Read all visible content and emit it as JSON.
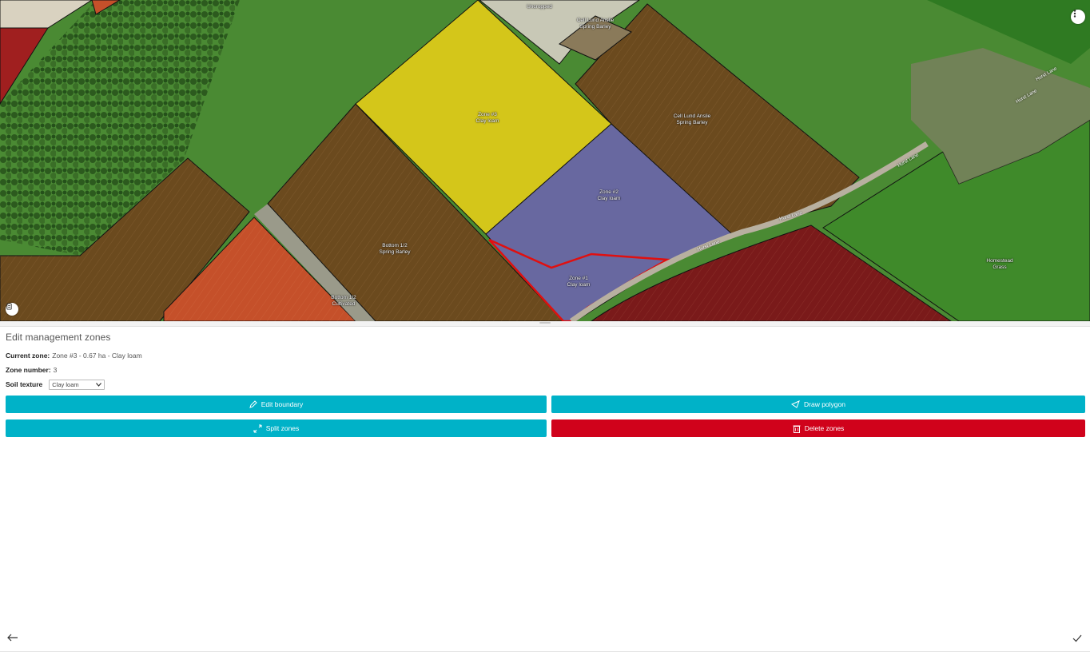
{
  "map": {
    "field_labels": [
      {
        "id": "zone3",
        "lines": [
          "Zone #3",
          "Clay loam"
        ]
      },
      {
        "id": "zone2",
        "lines": [
          "Zone #2",
          "Clay loam"
        ]
      },
      {
        "id": "zone1",
        "lines": [
          "Zone #1",
          "Clay loam"
        ]
      },
      {
        "id": "cell-upper",
        "lines": [
          "Cell Lund Anslie",
          "Spring Barley"
        ]
      },
      {
        "id": "bottom",
        "lines": [
          "Bottom 1/2",
          "Spring Barley"
        ]
      },
      {
        "id": "bottom-small",
        "lines": [
          "Bottom 1/2",
          "Cultivated"
        ]
      },
      {
        "id": "cell-small",
        "lines": [
          "Cell Lund Anslie",
          "Spring Barley"
        ]
      },
      {
        "id": "homestead",
        "lines": [
          "Homestead",
          "Grass"
        ]
      },
      {
        "id": "top",
        "lines": [
          "Uncropped"
        ]
      }
    ],
    "road_labels": [
      "Hurst Lane",
      "Hurst Lane",
      "Hurst Lane",
      "Hurst Lane",
      "Hurst Lane"
    ],
    "colors": {
      "zone_yellow": "#d4c61a",
      "zone_purple": "#6868a0",
      "brown": "#6b4a1e",
      "dark_red": "#7a1a1a",
      "orange": "#c5502a",
      "grass": "#4f8f35",
      "selection": "#e01010"
    }
  },
  "panel": {
    "title": "Edit management zones",
    "current_zone_label": "Current zone:",
    "current_zone_value": "Zone #3 - 0.67 ha - Clay loam",
    "zone_number_label": "Zone number:",
    "zone_number_value": "3",
    "soil_texture_label": "Soil texture",
    "soil_texture_value": "Clay loam"
  },
  "buttons": {
    "edit_boundary": "Edit boundary",
    "draw_polygon": "Draw polygon",
    "split_zones": "Split zones",
    "delete_zones": "Delete zones"
  },
  "icons": {
    "map_menu": "more-vertical-icon",
    "layers": "layers-icon",
    "back": "arrow-left-icon",
    "confirm": "check-icon"
  }
}
